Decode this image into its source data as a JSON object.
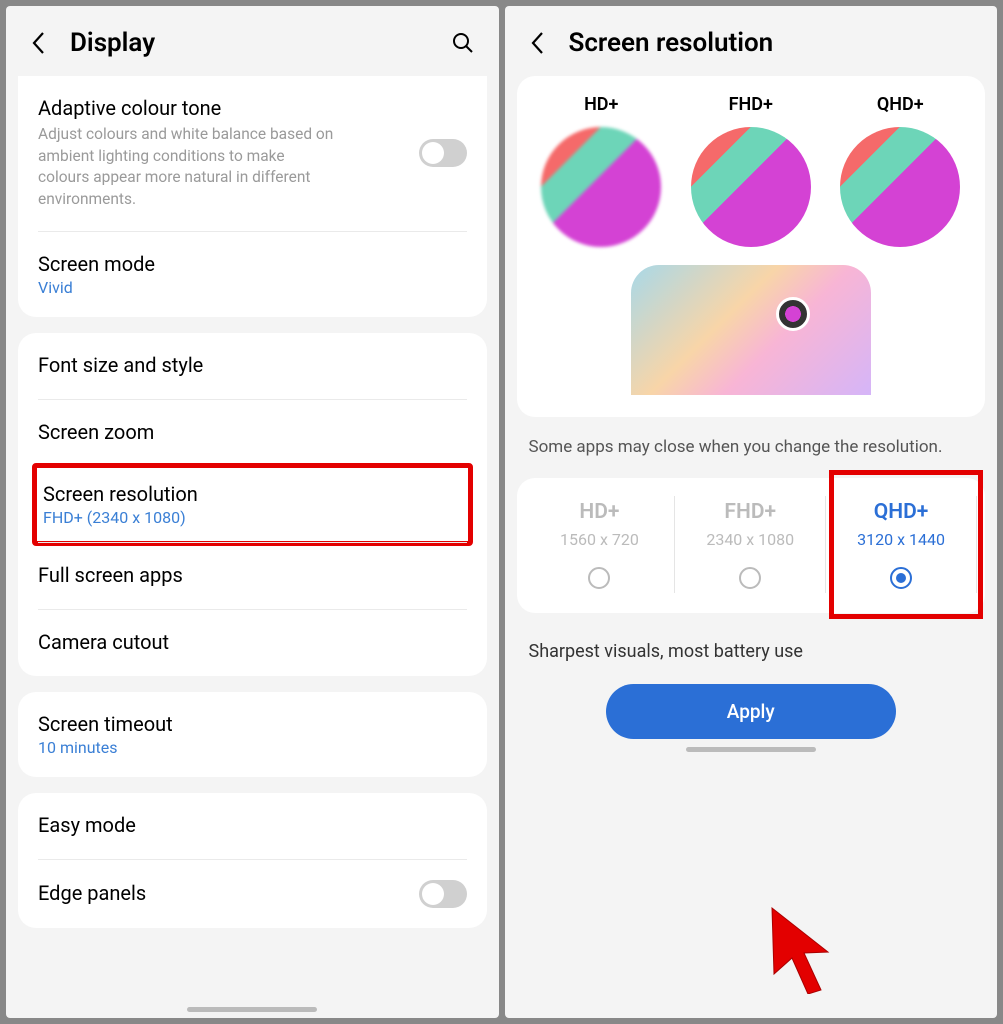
{
  "left": {
    "title": "Display",
    "adaptive": {
      "title": "Adaptive colour tone",
      "desc": "Adjust colours and white balance based on ambient lighting conditions to make colours appear more natural in different environments."
    },
    "screenMode": {
      "title": "Screen mode",
      "value": "Vivid"
    },
    "fontSize": "Font size and style",
    "screenZoom": "Screen zoom",
    "resolution": {
      "title": "Screen resolution",
      "value": "FHD+ (2340 x 1080)"
    },
    "fullScreen": "Full screen apps",
    "cameraCutout": "Camera cutout",
    "timeout": {
      "title": "Screen timeout",
      "value": "10 minutes"
    },
    "easyMode": "Easy mode",
    "edgePanels": "Edge panels"
  },
  "right": {
    "title": "Screen resolution",
    "previews": [
      "HD+",
      "FHD+",
      "QHD+"
    ],
    "warn": "Some apps may close when you change the resolution.",
    "options": [
      {
        "name": "HD+",
        "res": "1560 x 720"
      },
      {
        "name": "FHD+",
        "res": "2340 x 1080"
      },
      {
        "name": "QHD+",
        "res": "3120 x 1440"
      }
    ],
    "desc": "Sharpest visuals, most battery use",
    "apply": "Apply"
  }
}
